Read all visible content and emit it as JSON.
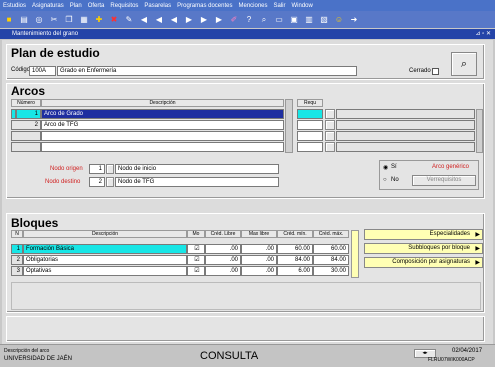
{
  "menu": [
    "Estudios",
    "Asignaturas",
    "Plan",
    "Oferta",
    "Requisitos",
    "Pasarelas",
    "Programas docentes",
    "Menciones",
    "Salir",
    "Window"
  ],
  "window_title": "Mantenimiento del grano",
  "header": {
    "title": "Plan de estudio",
    "codigo_label": "Código",
    "codigo_value": "100A",
    "descripcion_value": "Grado en Enfermería",
    "cerrado_label": "Cerrado"
  },
  "arcos": {
    "title": "Arcos",
    "col_numero": "Número",
    "col_descripcion": "Descripción",
    "col_requ": "Requ",
    "rows": [
      {
        "numero": "1",
        "descripcion": "Arco de Grado"
      },
      {
        "numero": "2",
        "descripcion": "Arco de TFG"
      }
    ],
    "nodo_origen_label": "Nodo origen",
    "nodo_origen_num": "1",
    "nodo_origen_desc": "Nodo de inicio",
    "nodo_destino_label": "Nodo destino",
    "nodo_destino_num": "2",
    "nodo_destino_desc": "Nodo de TFG",
    "si_label": "Sí",
    "no_label": "No",
    "arco_generico": "Arco genérico",
    "verrequisitos": "Verrequisitos"
  },
  "bloques": {
    "title": "Bloques",
    "col_n": "N",
    "col_descripcion": "Descripción",
    "col_mo": "Mo",
    "col_cred_libre": "Créd. Libre",
    "col_max_libre": "Max libre",
    "col_cred_min": "Créd. mín.",
    "col_cred_max": "Créd. máx.",
    "rows": [
      {
        "n": "1",
        "descripcion": "Formación Básica",
        "cred_libre": ".00",
        "max_libre": ".00",
        "cred_min": "60.00",
        "cred_max": "60.00"
      },
      {
        "n": "2",
        "descripcion": "Obligatorias",
        "cred_libre": ".00",
        "max_libre": ".00",
        "cred_min": "84.00",
        "cred_max": "84.00"
      },
      {
        "n": "3",
        "descripcion": "Optativas",
        "cred_libre": ".00",
        "max_libre": ".00",
        "cred_min": "6.00",
        "cred_max": "30.00"
      }
    ],
    "btn_especialidades": "Especialidades",
    "btn_subbloques": "Subbloques por bloque",
    "btn_composicion": "Composición por asignaturas"
  },
  "status": {
    "desc_label": "Descripción del arco",
    "university": "UNIVERSIDAD DE JAÉN",
    "mode": "CONSULTA",
    "date": "02/04/2017",
    "user": "FLRU07WIK000ACP"
  }
}
